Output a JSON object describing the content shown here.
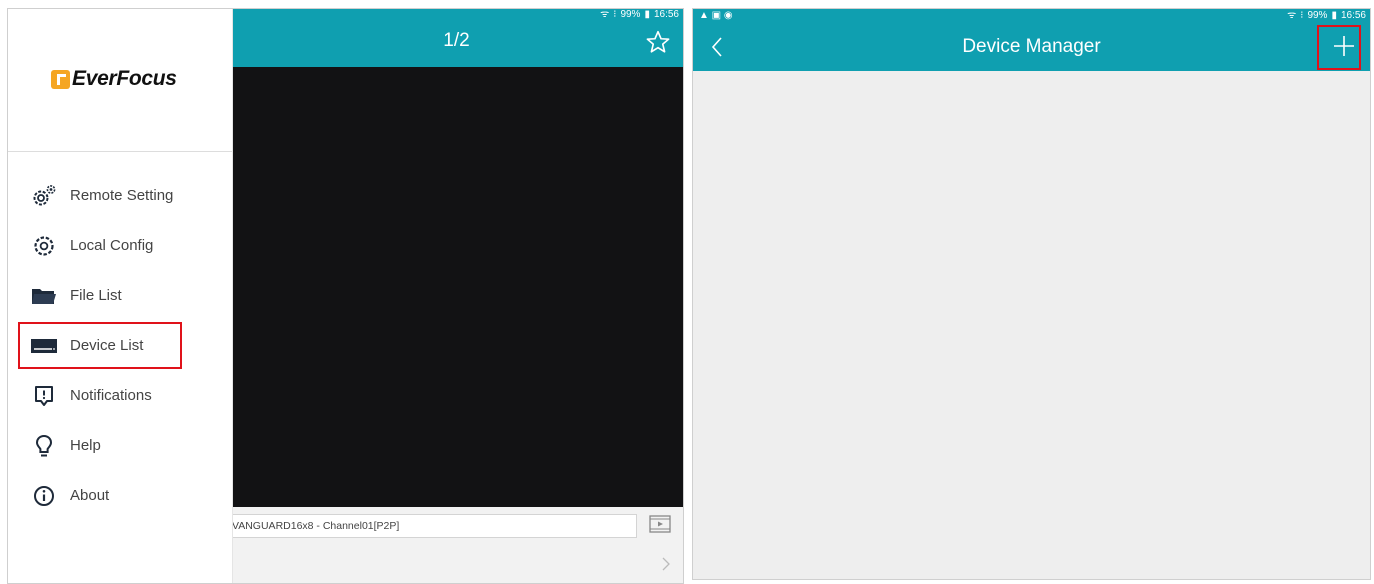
{
  "live_view": {
    "status_bar": {
      "wifi": "ᯤ",
      "signal": "⁝",
      "battery": "99%",
      "time": "16:56"
    },
    "page_indicator": "1/2",
    "channel_label": "VANGUARD16x8 - Channel01[P2P]"
  },
  "drawer": {
    "brand": "EverFocus",
    "items": [
      {
        "label": "Remote Setting",
        "icon": "remote-setting-icon"
      },
      {
        "label": "Local Config",
        "icon": "gear-icon"
      },
      {
        "label": "File List",
        "icon": "folder-icon"
      },
      {
        "label": "Device List",
        "icon": "device-list-icon"
      },
      {
        "label": "Notifications",
        "icon": "notification-icon"
      },
      {
        "label": "Help",
        "icon": "lightbulb-icon"
      },
      {
        "label": "About",
        "icon": "info-icon"
      }
    ],
    "highlighted_item": "Device List"
  },
  "device_manager": {
    "status_bar": {
      "left_icons": "▲ ▣ ◉",
      "wifi": "ᯤ",
      "signal": "⁝",
      "battery": "99%",
      "time": "16:56"
    },
    "title": "Device Manager",
    "highlighted_control": "add"
  },
  "colors": {
    "toolbar": "#0f9fb0",
    "highlight": "#e0121a",
    "video": "#121214",
    "brand_mark": "#f5a623"
  }
}
